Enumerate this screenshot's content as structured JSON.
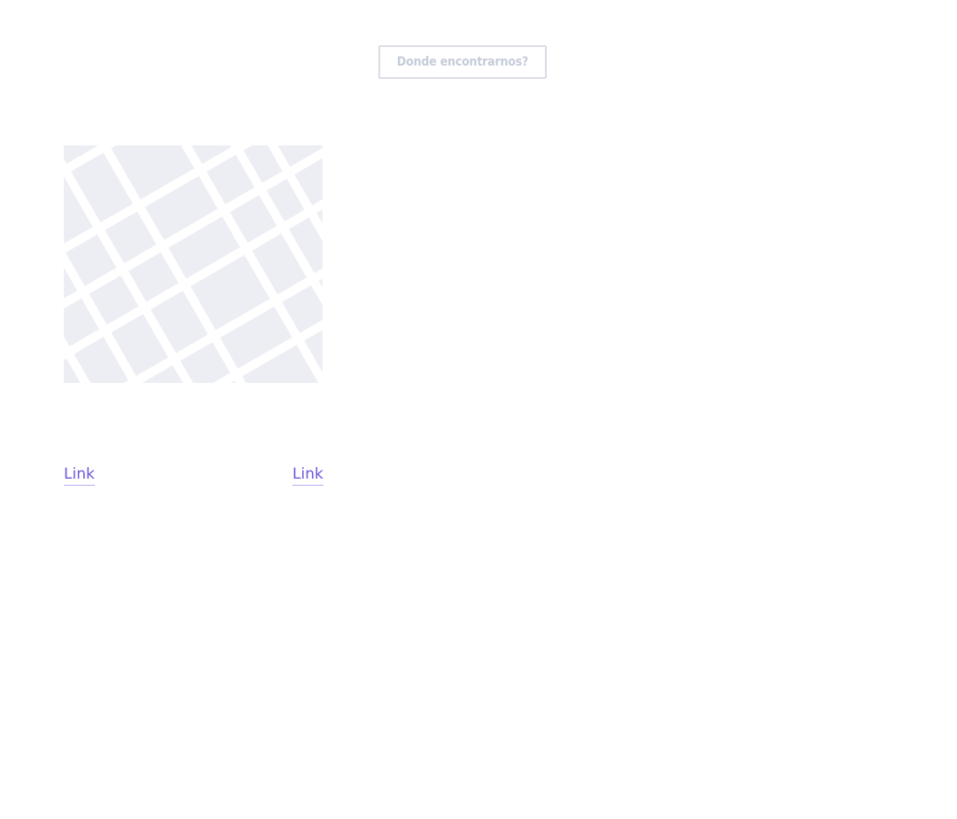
{
  "header": {
    "where_button_label": "Donde encontrarnos?"
  },
  "map": {
    "icon": "map-placeholder-icon",
    "colors": {
      "blocks": "#eceef3",
      "streets": "#ffffff"
    }
  },
  "links": [
    {
      "label": "Link"
    },
    {
      "label": "Link"
    }
  ],
  "colors": {
    "link": "#6b59d9",
    "link_underline": "#b7adf1",
    "button_border": "#d9dde6",
    "button_text": "#c5ccd8"
  }
}
